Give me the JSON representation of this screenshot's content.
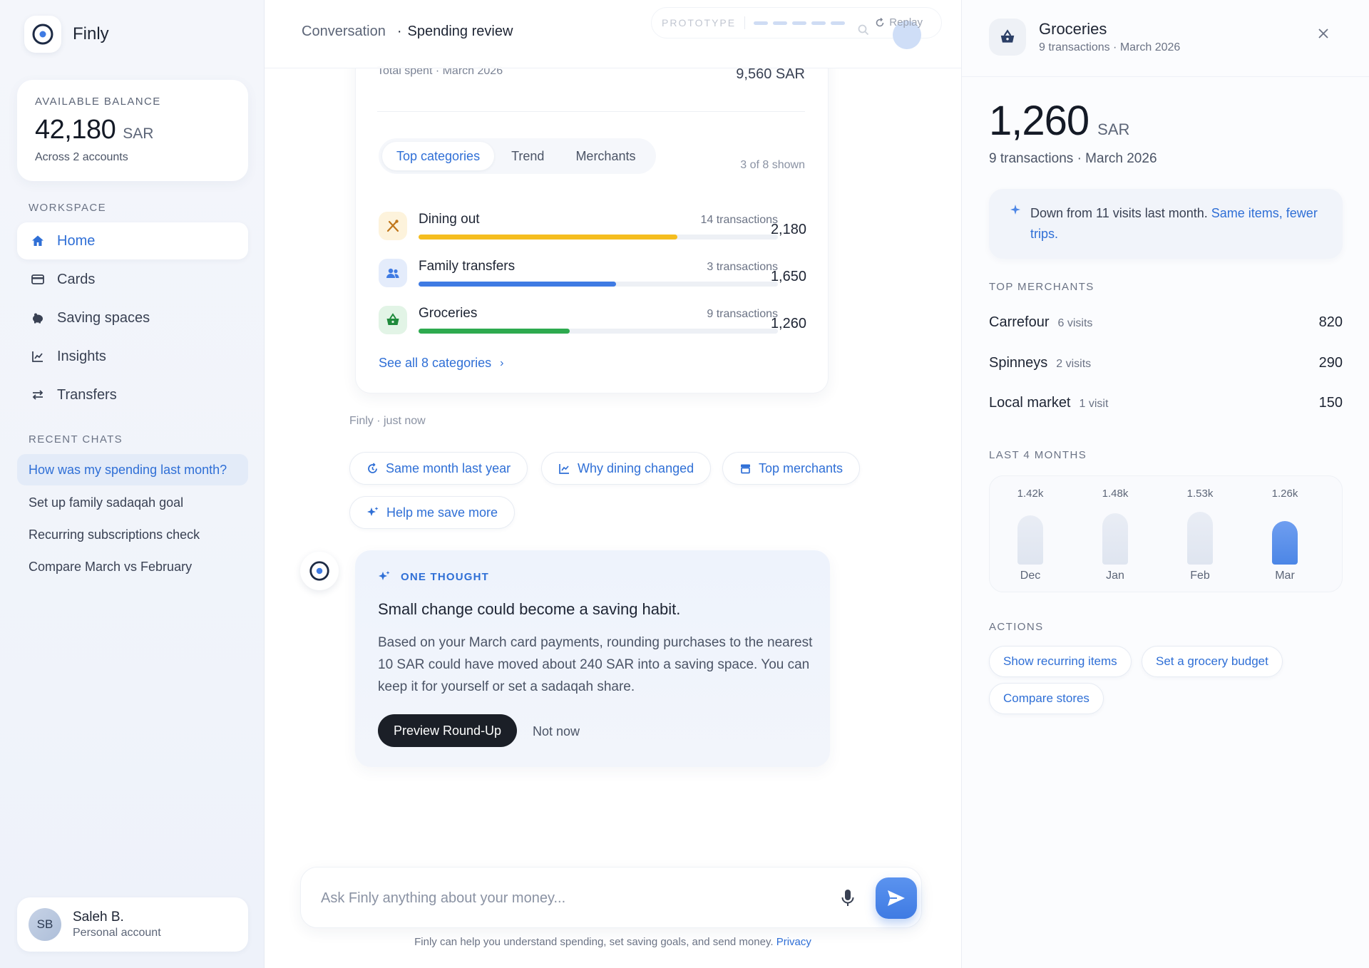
{
  "brand": {
    "name": "Finly"
  },
  "balance": {
    "label": "AVAILABLE BALANCE",
    "amount": "42,180",
    "currency": "SAR",
    "subtitle": "Across 2 accounts"
  },
  "sidebar": {
    "workspace_label": "WORKSPACE",
    "nav": [
      {
        "label": "Home",
        "icon": "home-icon",
        "active": true
      },
      {
        "label": "Cards",
        "icon": "card-icon"
      },
      {
        "label": "Saving spaces",
        "icon": "piggy-bank-icon"
      },
      {
        "label": "Insights",
        "icon": "chart-icon"
      },
      {
        "label": "Transfers",
        "icon": "transfer-icon"
      }
    ],
    "recent_label": "RECENT CHATS",
    "recent_chats": [
      {
        "label": "How was my spending last month?",
        "active": true
      },
      {
        "label": "Set up family sadaqah goal"
      },
      {
        "label": "Recurring subscriptions check"
      },
      {
        "label": "Compare March vs February"
      }
    ]
  },
  "user": {
    "initials": "SB",
    "name": "Saleh B.",
    "role": "Personal account"
  },
  "header": {
    "crumb_parent": "Conversation",
    "crumb_sep": "·",
    "crumb_current": "Spending review",
    "prototype_label": "PROTOTYPE",
    "replay_label": "Replay"
  },
  "report": {
    "total_label": "Total spent · March 2026",
    "total_value": "9,560 SAR",
    "tabs": [
      {
        "label": "Top categories",
        "active": true
      },
      {
        "label": "Trend"
      },
      {
        "label": "Merchants"
      }
    ],
    "shown_count": "3 of 8 shown",
    "categories": [
      {
        "name": "Dining out",
        "count": "14 transactions",
        "amount": "2,180",
        "share": 0.72,
        "color": "#f5bd1f",
        "icon_bg": "#fdf3dc",
        "icon": "fork-knife-icon"
      },
      {
        "name": "Family transfers",
        "count": "3 transactions",
        "amount": "1,650",
        "share": 0.55,
        "color": "#3f7be3",
        "icon_bg": "#e4ecfb",
        "icon": "people-icon"
      },
      {
        "name": "Groceries",
        "count": "9 transactions",
        "amount": "1,260",
        "share": 0.42,
        "color": "#2eaa4f",
        "icon_bg": "#e2f4e6",
        "icon": "basket-icon"
      }
    ],
    "see_all": "See all 8 categories"
  },
  "conversation": {
    "meta": "Finly · just now",
    "suggestions": [
      {
        "label": "Same month last year",
        "icon": "history-icon"
      },
      {
        "label": "Why dining changed",
        "icon": "chart-icon"
      },
      {
        "label": "Top merchants",
        "icon": "store-icon"
      },
      {
        "label": "Help me save more",
        "icon": "sparkle-icon"
      }
    ],
    "thought": {
      "kicker": "ONE THOUGHT",
      "title": "Small change could become a saving habit.",
      "body": "Based on your March card payments, rounding purchases to the nearest 10 SAR could have moved about 240 SAR into a saving space. You can keep it for yourself or set a sadaqah share.",
      "primary_action": "Preview Round-Up",
      "secondary_action": "Not now"
    }
  },
  "composer": {
    "placeholder": "Ask Finly anything about your money...",
    "footnote": "Finly can help you understand spending, set saving goals, and send money.",
    "privacy_link": "Privacy"
  },
  "detail": {
    "title": "Groceries",
    "subtitle": "9 transactions · March 2026",
    "amount": "1,260",
    "currency": "SAR",
    "summary": "9 transactions · March 2026",
    "insight_text": "Down from 11 visits last month.",
    "insight_link": "Same items, fewer trips.",
    "merchants_label": "TOP MERCHANTS",
    "merchants": [
      {
        "name": "Carrefour",
        "visits": "6 visits",
        "amount": "820"
      },
      {
        "name": "Spinneys",
        "visits": "2 visits",
        "amount": "290"
      },
      {
        "name": "Local market",
        "visits": "1 visit",
        "amount": "150"
      }
    ],
    "months_label": "LAST 4 MONTHS",
    "chart_data": {
      "type": "bar",
      "categories": [
        "Dec",
        "Jan",
        "Feb",
        "Mar"
      ],
      "values": [
        1420,
        1480,
        1530,
        1260
      ],
      "value_labels": [
        "1.42k",
        "1.48k",
        "1.53k",
        "1.26k"
      ],
      "highlight": "Mar",
      "bar_color": "#dfe5f0",
      "highlight_color": "#4c86e6"
    },
    "actions_label": "ACTIONS",
    "actions": [
      "Show recurring items",
      "Set a grocery budget",
      "Compare stores"
    ]
  }
}
